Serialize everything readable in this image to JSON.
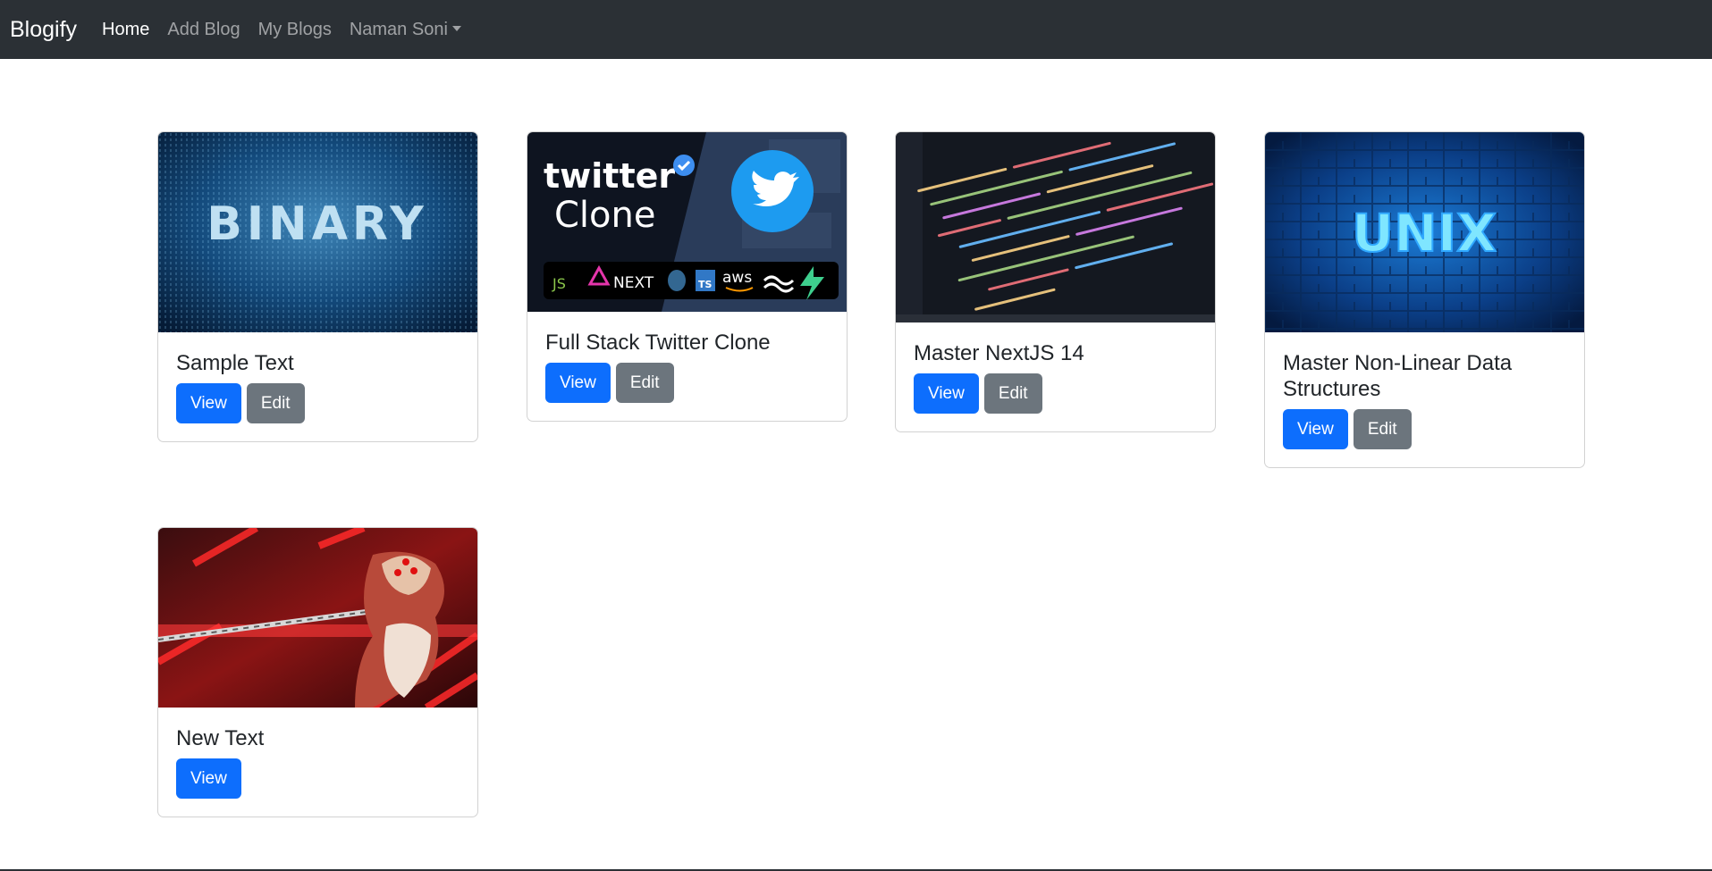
{
  "navbar": {
    "brand": "Blogify",
    "links": [
      {
        "label": "Home",
        "active": true
      },
      {
        "label": "Add Blog",
        "active": false
      },
      {
        "label": "My Blogs",
        "active": false
      },
      {
        "label": "Naman Soni",
        "active": false,
        "dropdown": true
      }
    ]
  },
  "cards": [
    {
      "title": "Sample Text",
      "image_text": "BINARY",
      "view_label": "View",
      "edit_label": "Edit"
    },
    {
      "title": "Full Stack Twitter Clone",
      "image_text": [
        "twitter",
        "Clone"
      ],
      "image_logos": [
        "JS",
        "NEXT",
        "TS",
        "aws"
      ],
      "view_label": "View",
      "edit_label": "Edit"
    },
    {
      "title": "Master NextJS 14",
      "view_label": "View",
      "edit_label": "Edit"
    },
    {
      "title": "Master Non-Linear Data Structures",
      "image_text": "UNIX",
      "view_label": "View",
      "edit_label": "Edit"
    },
    {
      "title": "New Text",
      "view_label": "View"
    }
  ],
  "colors": {
    "navbar_bg": "#2b3035",
    "primary": "#0d6efd",
    "secondary": "#6c757d"
  }
}
